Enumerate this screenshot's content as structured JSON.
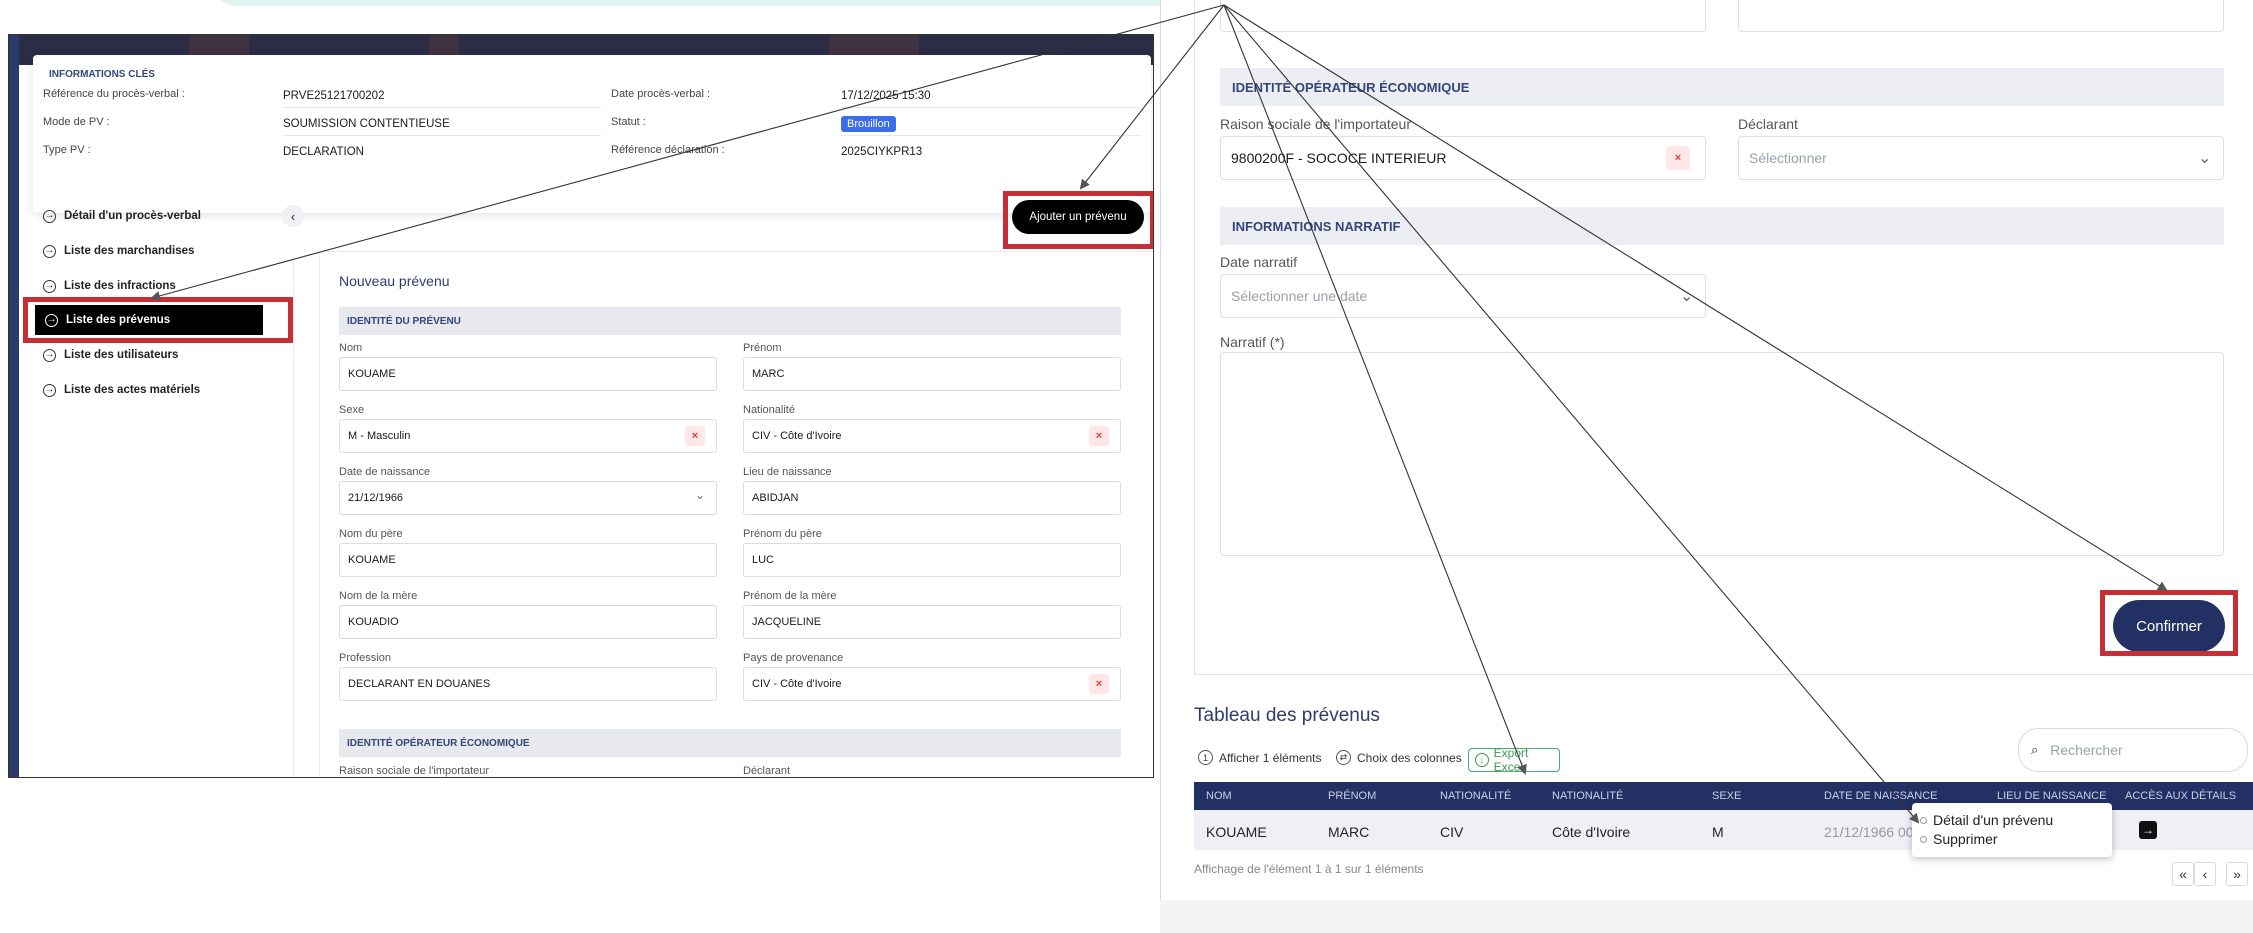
{
  "left": {
    "key_info": {
      "title": "INFORMATIONS CLÉS",
      "ref_label": "Référence du procès-verbal :",
      "ref_value": "PRVE25121700202",
      "mode_label": "Mode de PV :",
      "mode_value": "SOUMISSION CONTENTIEUSE",
      "type_label": "Type PV :",
      "type_value": "DECLARATION",
      "date_label": "Date procès-verbal :",
      "date_value": "17/12/2025 15:30",
      "status_label": "Statut :",
      "status_value": "Brouillon",
      "decl_label": "Référence déclaration :",
      "decl_value": "2025CIYKPR13"
    },
    "nav": [
      {
        "label": "Détail d'un procès-verbal"
      },
      {
        "label": "Liste des marchandises"
      },
      {
        "label": "Liste des infractions"
      },
      {
        "label": "Liste des prévenus"
      },
      {
        "label": "Liste des utilisateurs"
      },
      {
        "label": "Liste des actes matériels"
      }
    ],
    "add_button": "Ajouter un prévenu",
    "form_title": "Nouveau prévenu",
    "section_identity": "IDENTITÉ DU PRÉVENU",
    "section_operator": "IDENTITÉ OPÉRATEUR ÉCONOMIQUE",
    "fields": {
      "nom_label": "Nom",
      "nom_value": "KOUAME",
      "prenom_label": "Prénom",
      "prenom_value": "MARC",
      "sexe_label": "Sexe",
      "sexe_value": "M - Masculin",
      "nat_label": "Nationalité",
      "nat_value": "CIV - Côte d'Ivoire",
      "dob_label": "Date de naissance",
      "dob_value": "21/12/1966",
      "pob_label": "Lieu de naissance",
      "pob_value": "ABIDJAN",
      "pere_nom_label": "Nom du père",
      "pere_nom_value": "KOUAME",
      "pere_prenom_label": "Prénom du père",
      "pere_prenom_value": "LUC",
      "mere_nom_label": "Nom de la mère",
      "mere_nom_value": "KOUADIO",
      "mere_prenom_label": "Prénom de la mère",
      "mere_prenom_value": "JACQUELINE",
      "profession_label": "Profession",
      "profession_value": "DECLARANT EN DOUANES",
      "pays_label": "Pays de provenance",
      "pays_value": "CIV - Côte d'Ivoire",
      "raison_label": "Raison sociale de l'importateur",
      "declarant_label": "Déclarant"
    },
    "clear_glyph": "×",
    "collapse_glyph": "‹",
    "nav_icon_glyph": "→"
  },
  "right": {
    "section_operator": "IDENTITÉ OPÉRATEUR ÉCONOMIQUE",
    "raison_label": "Raison sociale de l'importateur",
    "raison_value": "9800200F - SOCOCE INTERIEUR",
    "declarant_label": "Déclarant",
    "declarant_placeholder": "Sélectionner",
    "section_narratif": "INFORMATIONS NARRATIF",
    "date_narratif_label": "Date narratif",
    "date_narratif_placeholder": "Sélectionner une date",
    "narratif_label": "Narratif (*)",
    "confirm_button": "Confirmer",
    "table_title": "Tableau des prévenus",
    "tools": {
      "show": "Afficher 1 éléments",
      "columns": "Choix des colonnes",
      "export": "Export Excel"
    },
    "search_placeholder": "Rechercher",
    "columns": [
      "NOM",
      "PRÉNOM",
      "NATIONALITÉ",
      "NATIONALITÉ",
      "SEXE",
      "DATE DE NAISSANCE",
      "LIEU DE NAISSANCE",
      "ACCÈS AUX DÉTAILS"
    ],
    "row": [
      "KOUAME",
      "MARC",
      "CIV",
      "Côte d'Ivoire",
      "M",
      "21/12/1966 00"
    ],
    "menu": [
      "Détail d'un prévenu",
      "Supprimer"
    ],
    "footer": "Affichage de l'élément 1 à 1 sur 1 éléments",
    "pagination": [
      "«",
      "‹",
      "»"
    ],
    "search_icon": "magnifier-icon",
    "chevron_glyph": "⌄",
    "details_glyph": "→"
  },
  "colors": {
    "accent_red": "#c62f36",
    "navy": "#233063",
    "status_blue": "#3b6ce9",
    "excel_green": "#3a9c57"
  }
}
